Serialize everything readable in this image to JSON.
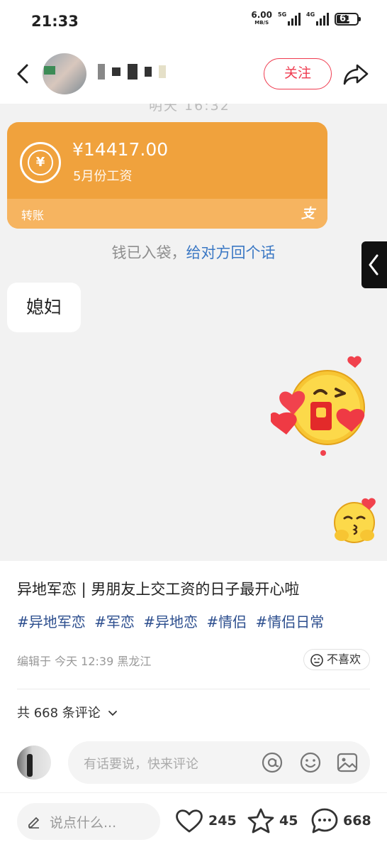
{
  "status_bar": {
    "time": "21:33",
    "net_speed": "6.00",
    "net_unit": "MB/S",
    "net_5g": "5G",
    "net_4g": "4G",
    "battery": "61"
  },
  "nav": {
    "follow_label": "关注"
  },
  "image": {
    "top_partial_text": "明天 16:32",
    "transfer": {
      "amount": "¥14417.00",
      "note": "5月份工资",
      "footer_label": "转账",
      "footer_icon": "支",
      "coin_symbol": "¥"
    },
    "notice": {
      "text": "钱已入袋，",
      "link": "给对方回个话"
    },
    "bubble_text": "媳妇"
  },
  "post": {
    "title": "异地军恋 | 男朋友上交工资的日子最开心啦",
    "tags": [
      "#异地军恋",
      "#军恋",
      "#异地恋",
      "#情侣",
      "#情侣日常"
    ],
    "meta": "编辑于 今天 12:39 黑龙江",
    "dislike_label": "不喜欢"
  },
  "comments": {
    "count_label": "共 668 条评论",
    "input_placeholder": "有话要说，快来评论"
  },
  "bottom_bar": {
    "say_placeholder": "说点什么...",
    "likes": "245",
    "stars": "45",
    "comments": "668"
  },
  "colors": {
    "accent": "#ef3b4f",
    "transfer_card": "#f0a23d",
    "tag": "#2c4e8e",
    "link": "#3b78c4"
  }
}
